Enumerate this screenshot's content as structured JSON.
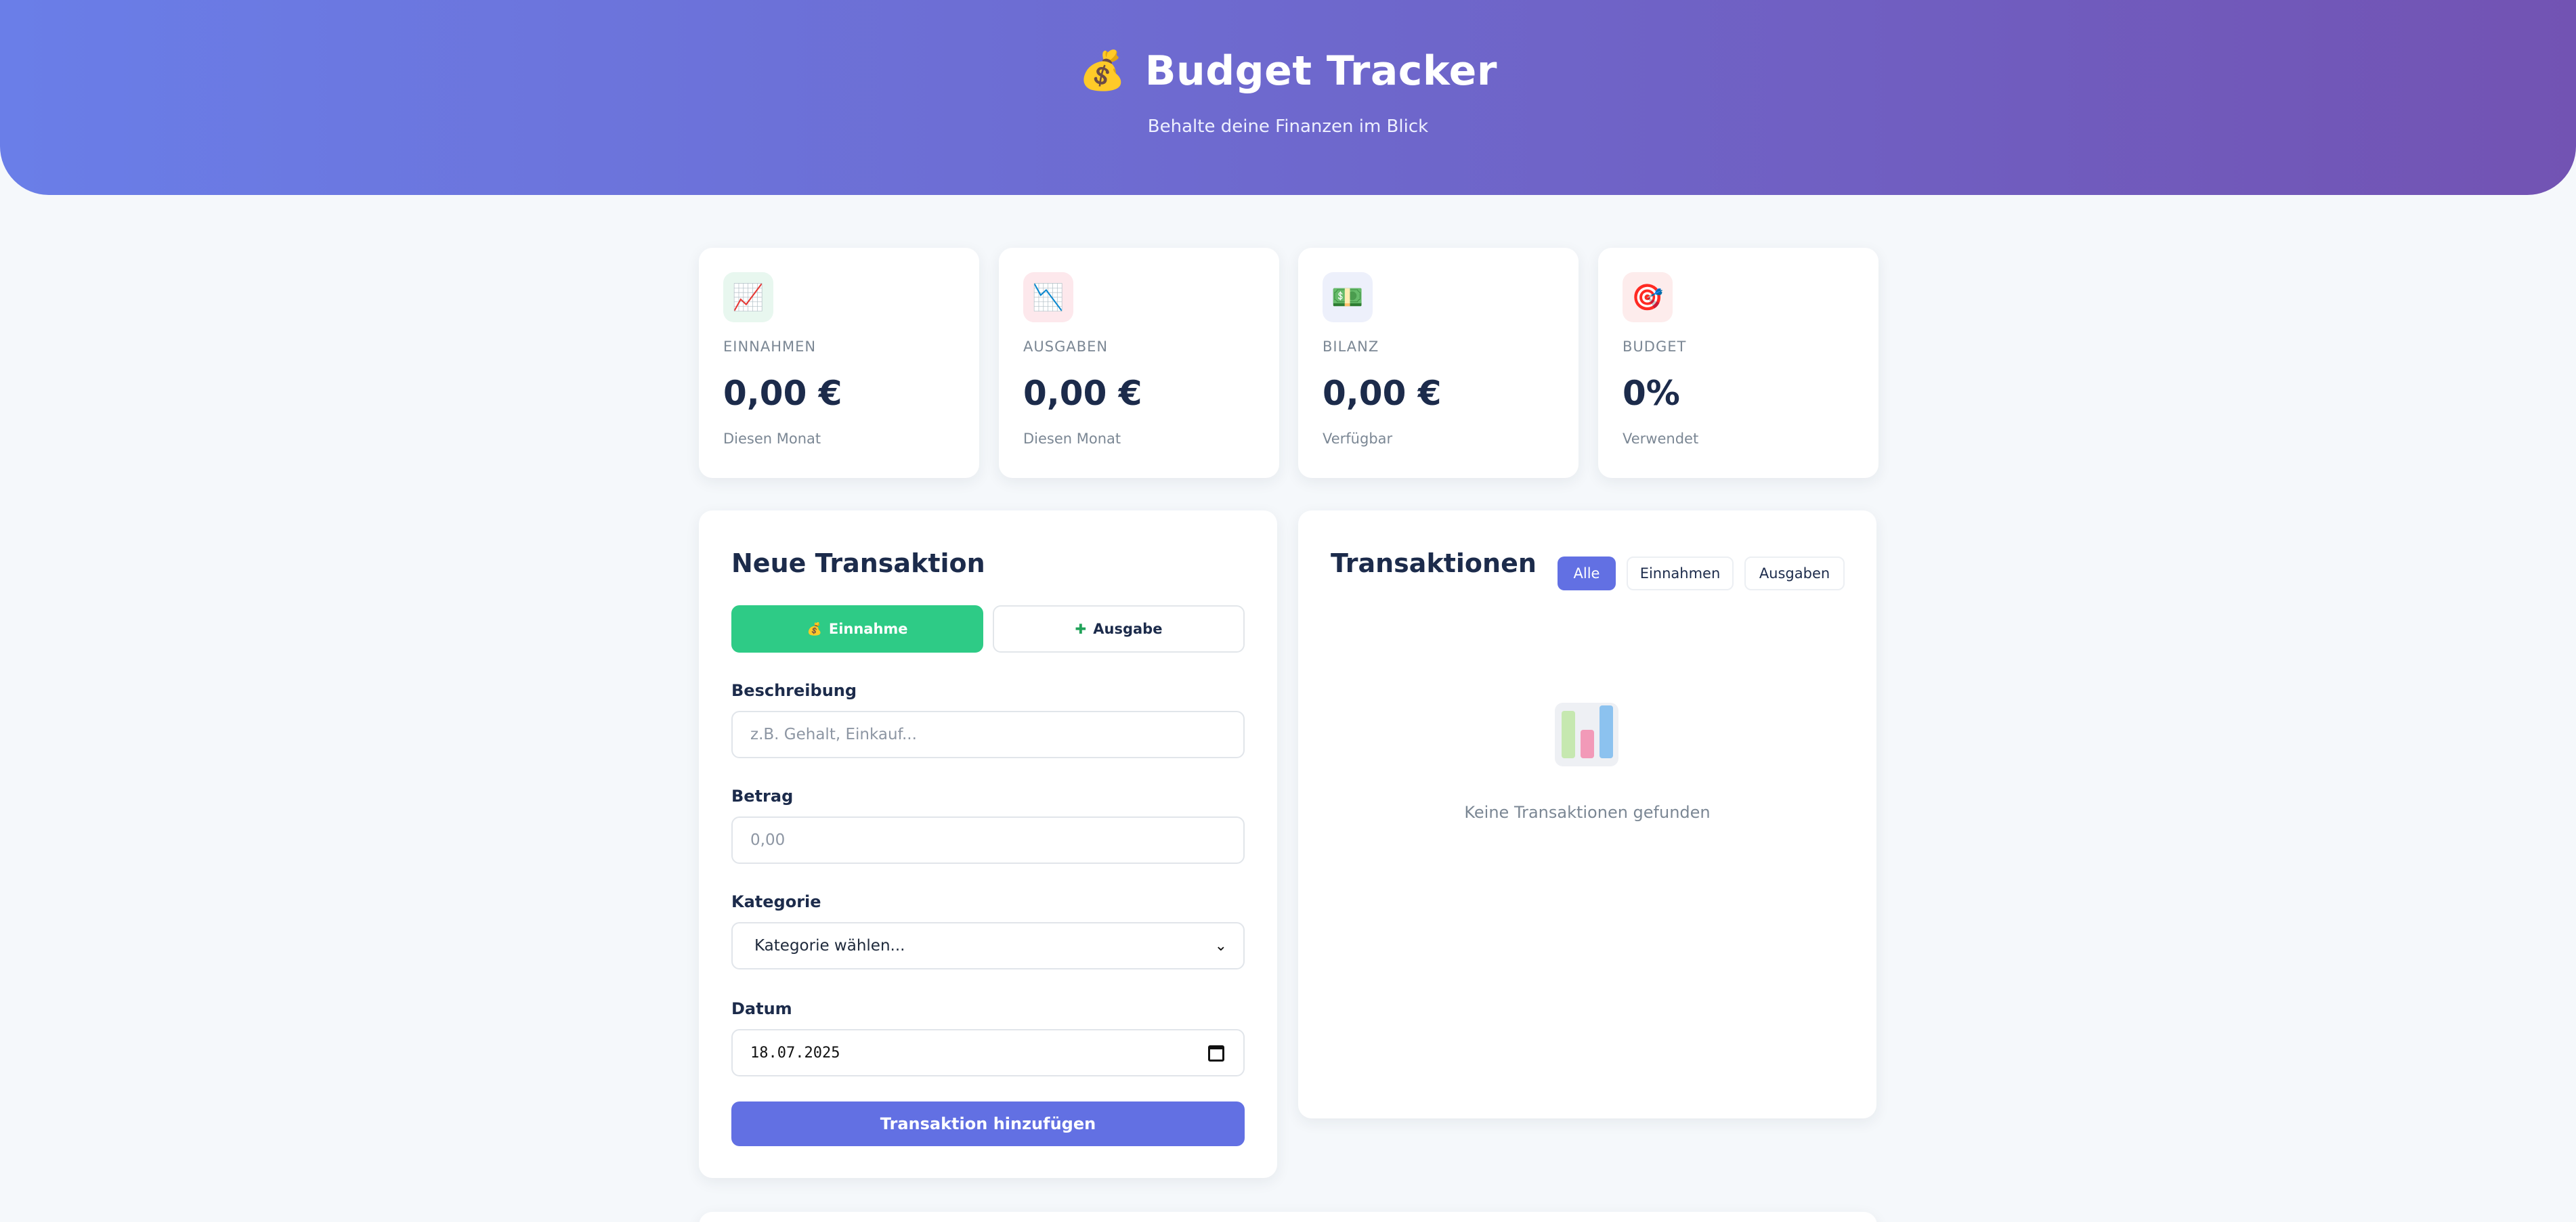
{
  "header": {
    "icon": "money-bag-icon",
    "icon_glyph": "💰",
    "title": "Budget Tracker",
    "subtitle": "Behalte deine Finanzen im Blick"
  },
  "stats": [
    {
      "icon": "chart-up-icon",
      "glyph": "📈",
      "label": "EINNAHMEN",
      "value": "0,00 €",
      "sub": "Diesen Monat",
      "icon_bg": "#e8f7ef"
    },
    {
      "icon": "chart-down-icon",
      "glyph": "📉",
      "label": "AUSGABEN",
      "value": "0,00 €",
      "sub": "Diesen Monat",
      "icon_bg": "#fde8ec"
    },
    {
      "icon": "banknote-icon",
      "glyph": "💵",
      "label": "BILANZ",
      "value": "0,00 €",
      "sub": "Verfügbar",
      "icon_bg": "#edf0fb"
    },
    {
      "icon": "target-icon",
      "glyph": "🎯",
      "label": "BUDGET",
      "value": "0%",
      "sub": "Verwendet",
      "icon_bg": "#fdecec"
    }
  ],
  "form": {
    "title": "Neue Transaktion",
    "type_buttons": [
      {
        "icon": "moneybag-icon",
        "glyph": "💰",
        "label": "Einnahme",
        "active": true
      },
      {
        "icon": "cross-icon",
        "glyph": "✚",
        "label": "Ausgabe",
        "active": false
      }
    ],
    "description": {
      "label": "Beschreibung",
      "placeholder": "z.B. Gehalt, Einkauf..."
    },
    "amount": {
      "label": "Betrag",
      "placeholder": "0,00"
    },
    "category": {
      "label": "Kategorie",
      "selected": "Kategorie wählen..."
    },
    "date": {
      "label": "Datum",
      "value": "18.07.2025"
    },
    "submit_label": "Transaktion hinzufügen"
  },
  "transactions": {
    "title": "Transaktionen",
    "filters": [
      {
        "label": "Alle",
        "active": true
      },
      {
        "label": "Einnahmen",
        "active": false
      },
      {
        "label": "Ausgaben",
        "active": false
      }
    ],
    "empty_icon": "bar-chart-icon",
    "empty_text": "Keine Transaktionen gefunden"
  },
  "colors": {
    "accent": "#6270e3",
    "income_green": "#2ecb86",
    "header_gradient_start": "#6a7ee8",
    "header_gradient_end": "#7253b3"
  }
}
